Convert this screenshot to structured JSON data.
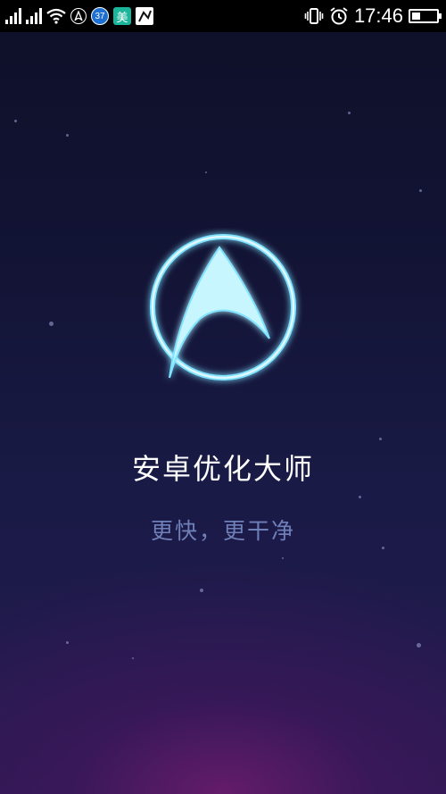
{
  "status_bar": {
    "time": "17:46",
    "notification_count": "37",
    "app_badge": "美",
    "icons": [
      "signal-icon",
      "signal-icon-2",
      "wifi-icon",
      "navigation-app-icon",
      "notification-count-badge",
      "meituan-icon",
      "app-notification-icon",
      "vibrate-icon",
      "alarm-icon",
      "battery-icon"
    ]
  },
  "splash": {
    "app_name": "安卓优化大师",
    "tagline": "更快，更干净"
  },
  "colors": {
    "logo_glow": "#7fe3ff",
    "tagline": "#6f7fb8",
    "background_top": "#0e1028",
    "background_bottom_glow": "#6e1c6e"
  }
}
